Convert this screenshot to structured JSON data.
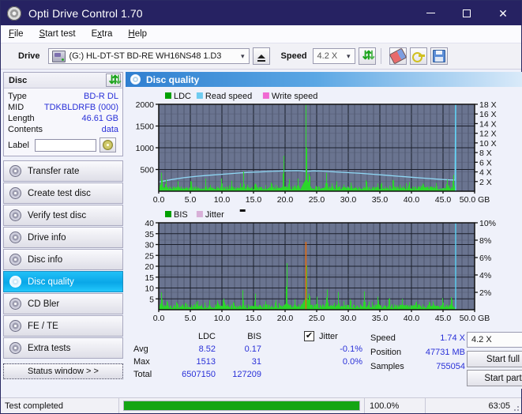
{
  "window": {
    "title": "Opti Drive Control 1.70",
    "icon": "disc-icon",
    "minimize": "—",
    "maximize": "□",
    "close": "✕"
  },
  "menu": {
    "items": [
      "File",
      "Start test",
      "Extra",
      "Help"
    ]
  },
  "toolbar": {
    "drive_label": "Drive",
    "drive_value": "(G:)  HL-DT-ST BD-RE  WH16NS48 1.D3",
    "eject_title": "Eject",
    "speed_label": "Speed",
    "speed_value": "4.2 X",
    "refresh_title": "Refresh",
    "erase_title": "Erase",
    "key_title": "Key",
    "save_title": "Save"
  },
  "disc": {
    "title": "Disc",
    "refresh_title": "Refresh disc info",
    "rows": [
      {
        "key": "Type",
        "value": "BD-R DL"
      },
      {
        "key": "MID",
        "value": "TDKBLDRFB (000)"
      },
      {
        "key": "Length",
        "value": "46.61 GB"
      },
      {
        "key": "Contents",
        "value": "data"
      }
    ],
    "label_key": "Label",
    "label_value": "",
    "label_placeholder": ""
  },
  "nav": {
    "items": [
      {
        "label": "Transfer rate",
        "active": false
      },
      {
        "label": "Create test disc",
        "active": false
      },
      {
        "label": "Verify test disc",
        "active": false
      },
      {
        "label": "Drive info",
        "active": false
      },
      {
        "label": "Disc info",
        "active": false
      },
      {
        "label": "Disc quality",
        "active": true
      },
      {
        "label": "CD Bler",
        "active": false
      },
      {
        "label": "FE / TE",
        "active": false
      },
      {
        "label": "Extra tests",
        "active": false
      }
    ],
    "status_window": "Status window > >"
  },
  "panel": {
    "title": "Disc quality",
    "icon": "disc-quality-icon"
  },
  "chart_data": [
    {
      "type": "line",
      "name": "ldc-chart",
      "title": "",
      "xlabel": "GB",
      "ylabel": "",
      "legend": [
        {
          "label": "LDC",
          "color": "#00a000"
        },
        {
          "label": "Read speed",
          "color": "#6ecbf0"
        },
        {
          "label": "Write speed",
          "color": "#f06ad2"
        }
      ],
      "legend_position": "top-left",
      "grid": true,
      "plot_bg": "#6a7490",
      "xlim": [
        0,
        50
      ],
      "xticks": [
        0.0,
        5.0,
        10.0,
        15.0,
        20.0,
        25.0,
        30.0,
        35.0,
        40.0,
        45.0,
        50.0
      ],
      "xticklabels": [
        "0.0",
        "5.0",
        "10.0",
        "15.0",
        "20.0",
        "25.0",
        "30.0",
        "35.0",
        "40.0",
        "45.0",
        "50.0 GB"
      ],
      "ylim": [
        0,
        2000
      ],
      "yticks": [
        500,
        1000,
        1500,
        2000
      ],
      "yticklabels": [
        "500",
        "1000",
        "1500",
        "2000"
      ],
      "y2lim": [
        0,
        18
      ],
      "y2ticks": [
        2,
        4,
        6,
        8,
        10,
        12,
        14,
        16,
        18
      ],
      "y2ticklabels": [
        "2 X",
        "4 X",
        "6 X",
        "8 X",
        "10 X",
        "12 X",
        "14 X",
        "16 X",
        "18 X"
      ],
      "series": [
        {
          "name": "Read speed",
          "color": "#8fd8f5",
          "axis": "right",
          "x": [
            0,
            2,
            4,
            6,
            8,
            10,
            12,
            14,
            16,
            18,
            20,
            22,
            23.5,
            24.5,
            26,
            28,
            30,
            32,
            34,
            36,
            38,
            40,
            42,
            44,
            46,
            46.9,
            47.0
          ],
          "y": [
            1.9,
            2.4,
            2.8,
            3.1,
            3.3,
            3.5,
            3.7,
            3.9,
            4.0,
            4.1,
            4.2,
            4.25,
            4.1,
            4.2,
            4.15,
            4.0,
            3.85,
            3.7,
            3.5,
            3.3,
            3.1,
            2.9,
            2.7,
            2.5,
            2.35,
            2.3,
            18.0
          ]
        },
        {
          "name": "LDC",
          "color": "#2bd62b",
          "axis": "left",
          "peaks": [
            {
              "x": 0.4,
              "y": 480
            },
            {
              "x": 1.1,
              "y": 300
            },
            {
              "x": 3.0,
              "y": 230
            },
            {
              "x": 5.1,
              "y": 250
            },
            {
              "x": 7.4,
              "y": 190
            },
            {
              "x": 9.9,
              "y": 330
            },
            {
              "x": 11.5,
              "y": 240
            },
            {
              "x": 13.4,
              "y": 300
            },
            {
              "x": 15.3,
              "y": 230
            },
            {
              "x": 17.8,
              "y": 260
            },
            {
              "x": 19.7,
              "y": 620
            },
            {
              "x": 20.6,
              "y": 310
            },
            {
              "x": 22.0,
              "y": 290
            },
            {
              "x": 23.3,
              "y": 1513
            },
            {
              "x": 23.8,
              "y": 520
            },
            {
              "x": 26.5,
              "y": 420
            },
            {
              "x": 28.1,
              "y": 260
            },
            {
              "x": 30.4,
              "y": 220
            },
            {
              "x": 32.8,
              "y": 330
            },
            {
              "x": 35.2,
              "y": 250
            },
            {
              "x": 37.1,
              "y": 280
            },
            {
              "x": 39.6,
              "y": 240
            },
            {
              "x": 41.8,
              "y": 230
            },
            {
              "x": 43.9,
              "y": 210
            },
            {
              "x": 45.6,
              "y": 300
            },
            {
              "x": 46.6,
              "y": 420
            }
          ],
          "baseline": 90,
          "xmax": 47.0
        }
      ]
    },
    {
      "type": "line",
      "name": "bis-chart",
      "title": "",
      "xlabel": "GB",
      "ylabel": "",
      "legend": [
        {
          "label": "BIS",
          "color": "#00a000"
        },
        {
          "label": "Jitter",
          "color": "#d8b0d8"
        }
      ],
      "legend_position": "top-left",
      "grid": true,
      "plot_bg": "#6a7490",
      "xlim": [
        0,
        50
      ],
      "xticks": [
        0.0,
        5.0,
        10.0,
        15.0,
        20.0,
        25.0,
        30.0,
        35.0,
        40.0,
        45.0,
        50.0
      ],
      "xticklabels": [
        "0.0",
        "5.0",
        "10.0",
        "15.0",
        "20.0",
        "25.0",
        "30.0",
        "35.0",
        "40.0",
        "45.0",
        "50.0 GB"
      ],
      "ylim": [
        0,
        40
      ],
      "yticks": [
        5,
        10,
        15,
        20,
        25,
        30,
        35,
        40
      ],
      "yticklabels": [
        "5",
        "10",
        "15",
        "20",
        "25",
        "30",
        "35",
        "40"
      ],
      "y2lim": [
        0,
        10
      ],
      "y2ticks": [
        2,
        4,
        6,
        8,
        10
      ],
      "y2ticklabels": [
        "2%",
        "4%",
        "6%",
        "8%",
        "10%"
      ],
      "series": [
        {
          "name": "BIS",
          "color": "#2bd62b",
          "axis": "left",
          "peaks": [
            {
              "x": 0.4,
              "y": 9.0
            },
            {
              "x": 1.3,
              "y": 5.2
            },
            {
              "x": 2.8,
              "y": 4.6
            },
            {
              "x": 4.2,
              "y": 4.2
            },
            {
              "x": 6.1,
              "y": 4.5
            },
            {
              "x": 8.0,
              "y": 4.3
            },
            {
              "x": 10.2,
              "y": 6.6
            },
            {
              "x": 11.8,
              "y": 4.6
            },
            {
              "x": 13.3,
              "y": 6.8
            },
            {
              "x": 15.2,
              "y": 5.6
            },
            {
              "x": 16.9,
              "y": 4.4
            },
            {
              "x": 18.5,
              "y": 4.4
            },
            {
              "x": 20.2,
              "y": 16.3
            },
            {
              "x": 21.5,
              "y": 4.8
            },
            {
              "x": 23.3,
              "y": 31.0
            },
            {
              "x": 23.8,
              "y": 9.5
            },
            {
              "x": 25.0,
              "y": 6.0
            },
            {
              "x": 26.6,
              "y": 10.4
            },
            {
              "x": 28.4,
              "y": 5.4
            },
            {
              "x": 30.3,
              "y": 6.3
            },
            {
              "x": 32.5,
              "y": 8.4
            },
            {
              "x": 34.7,
              "y": 5.4
            },
            {
              "x": 36.4,
              "y": 5.6
            },
            {
              "x": 38.5,
              "y": 5.0
            },
            {
              "x": 40.7,
              "y": 4.9
            },
            {
              "x": 42.8,
              "y": 4.8
            },
            {
              "x": 44.9,
              "y": 6.0
            },
            {
              "x": 46.3,
              "y": 7.4
            }
          ],
          "baseline": 2.0,
          "xmax": 47.0
        },
        {
          "name": "Jitter",
          "color": "#e06a10",
          "axis": "right",
          "x": [
            23.3
          ],
          "y": [
            7.8
          ]
        },
        {
          "name": "End marker",
          "color": "#5ad2f5",
          "axis": "right",
          "x": [
            47.0
          ],
          "y": [
            10.0
          ]
        }
      ]
    }
  ],
  "stats": {
    "headers": {
      "ldc": "LDC",
      "bis": "BIS",
      "jitter": "Jitter"
    },
    "jitter_checked": true,
    "jitter_check_glyph": "✔",
    "rows": [
      {
        "label": "Avg",
        "ldc": "8.52",
        "bis": "0.17",
        "jitter": "-0.1%"
      },
      {
        "label": "Max",
        "ldc": "1513",
        "bis": "31",
        "jitter": "0.0%"
      },
      {
        "label": "Total",
        "ldc": "6507150",
        "bis": "127209",
        "jitter": ""
      }
    ],
    "info": [
      {
        "label": "Speed",
        "value": "1.74 X"
      },
      {
        "label": "Position",
        "value": "47731 MB"
      },
      {
        "label": "Samples",
        "value": "755054"
      }
    ],
    "speed_select": "4.2 X",
    "start_full": "Start full",
    "start_part": "Start part"
  },
  "statusbar": {
    "message": "Test completed",
    "progress_percent": 100.0,
    "progress_text": "100.0%",
    "elapsed": "63:05"
  },
  "colors": {
    "titlebar": "#262262",
    "accent": "#2930d8",
    "plot_bg": "#6a7490",
    "ldc_green": "#2bd62b",
    "read_speed": "#8fd8f5",
    "write_speed": "#f06ad2",
    "jitter": "#d8b0d8",
    "progress": "#14a514",
    "nav_active": "#0aa7e8"
  }
}
